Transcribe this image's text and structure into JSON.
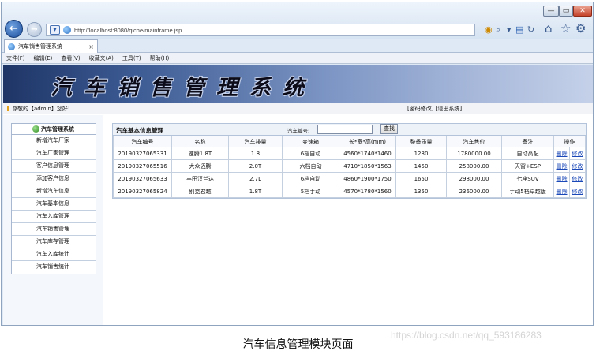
{
  "browser": {
    "window_controls": {
      "minimize": "—",
      "maximize": "▭",
      "close": "✕"
    },
    "url": "http://localhost:8080/qiche/mainframe.jsp",
    "tab_title": "汽车销售管理系统",
    "tab_close": "×",
    "menu": [
      "文件(F)",
      "编辑(E)",
      "查看(V)",
      "收藏夹(A)",
      "工具(T)",
      "帮助(H)"
    ],
    "icons": [
      "back-arrow-icon",
      "forward-arrow-icon",
      "compat-view-icon",
      "search-icon",
      "rss-icon",
      "refresh-icon",
      "home-icon",
      "favorites-star-icon",
      "gear-icon"
    ]
  },
  "header": {
    "banner_title": "汽车销售管理系统",
    "welcome": "尊敬的【admin】您好!",
    "links": "[密码修改] [退出系统]"
  },
  "sidebar": {
    "title": "汽车管理系统",
    "items": [
      "新增汽车厂家",
      "汽车厂家管理",
      "客户信息管理",
      "添加客户信息",
      "新增汽车信息",
      "汽车基本信息",
      "汽车入库管理",
      "汽车销售管理",
      "汽车库存管理",
      "汽车入库统计",
      "汽车销售统计"
    ]
  },
  "main": {
    "title": "汽车基本信息管理",
    "search": {
      "label": "汽车编号:",
      "value": "",
      "button": "查找"
    },
    "columns": [
      "汽车编号",
      "名称",
      "汽车排量",
      "变速箱",
      "长*宽*高(mm)",
      "整备质量",
      "汽车售价",
      "备注",
      "操作"
    ],
    "rows": [
      {
        "id": "20190327065331",
        "name": "速腾1.8T",
        "displacement": "1.8",
        "gearbox": "6档自动",
        "dims": "4560*1740*1460",
        "weight": "1280",
        "price": "1780000.00",
        "note": "自动高配",
        "del": "删除",
        "edit": "修改"
      },
      {
        "id": "20190327065516",
        "name": "大众迈腾",
        "displacement": "2.0T",
        "gearbox": "六档自动",
        "dims": "4710*1850*1563",
        "weight": "1450",
        "price": "258000.00",
        "note": "天窗+ESP",
        "del": "删除",
        "edit": "修改"
      },
      {
        "id": "20190327065633",
        "name": "丰田汉兰达",
        "displacement": "2.7L",
        "gearbox": "6档自动",
        "dims": "4860*1900*1750",
        "weight": "1650",
        "price": "298000.00",
        "note": "七座SUV",
        "del": "删除",
        "edit": "修改"
      },
      {
        "id": "20190327065824",
        "name": "别克君越",
        "displacement": "1.8T",
        "gearbox": "5档手动",
        "dims": "4570*1780*1560",
        "weight": "1350",
        "price": "236000.00",
        "note": "手动5档卓越版",
        "del": "删除",
        "edit": "修改"
      }
    ]
  },
  "caption": "汽车信息管理模块页面",
  "watermark": "https://blog.csdn.net/qq_593186283"
}
